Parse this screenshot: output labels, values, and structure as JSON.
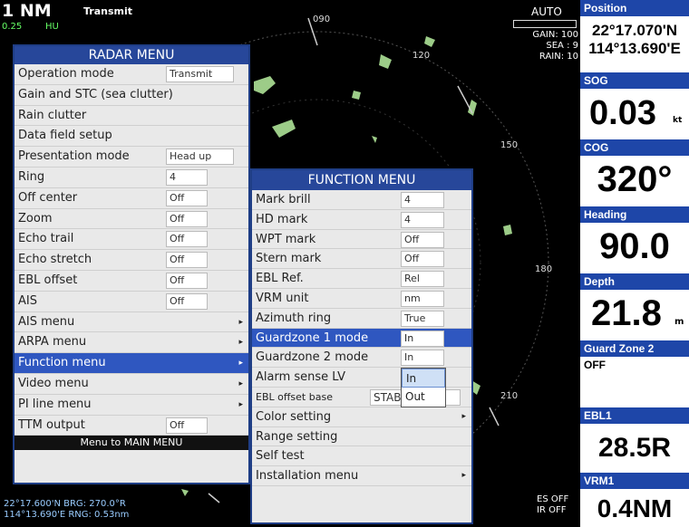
{
  "status": {
    "range": "1 NM",
    "tx": "Transmit",
    "ring_interval": "0.25",
    "orientation": "HU",
    "mode_auto": "AUTO",
    "gain": "GAIN: 100",
    "sea": "SEA :   9",
    "rain": "RAIN:  10",
    "es": "ES OFF",
    "ir": "IR OFF",
    "cursor_lat": "22°17.600'N  BRG: 270.0°R",
    "cursor_lon": "114°13.690'E  RNG: 0.53nm"
  },
  "bearings": [
    "090",
    "120",
    "150",
    "180",
    "210"
  ],
  "radar_menu": {
    "title": "RADAR MENU",
    "footer": "Menu to MAIN MENU",
    "items": [
      {
        "label": "Operation mode",
        "value": "Transmit"
      },
      {
        "label": "Gain and STC (sea clutter)"
      },
      {
        "label": "Rain clutter"
      },
      {
        "label": "Data field setup"
      },
      {
        "label": "Presentation mode",
        "value": "Head up"
      },
      {
        "label": "Ring",
        "value": "4"
      },
      {
        "label": "Off center",
        "value": "Off"
      },
      {
        "label": "Zoom",
        "value": "Off"
      },
      {
        "label": "Echo trail",
        "value": "Off"
      },
      {
        "label": "Echo stretch",
        "value": "Off"
      },
      {
        "label": "EBL offset",
        "value": "Off"
      },
      {
        "label": "AIS",
        "value": "Off"
      },
      {
        "label": "AIS menu",
        "submenu": true
      },
      {
        "label": "ARPA menu",
        "submenu": true
      },
      {
        "label": "Function menu",
        "submenu": true,
        "selected": true
      },
      {
        "label": "Video menu",
        "submenu": true
      },
      {
        "label": "PI line menu",
        "submenu": true
      },
      {
        "label": "TTM output",
        "value": "Off"
      }
    ]
  },
  "function_menu": {
    "title": "FUNCTION MENU",
    "items": [
      {
        "label": "Mark brill",
        "value": "4"
      },
      {
        "label": "HD mark",
        "value": "4"
      },
      {
        "label": "WPT mark",
        "value": "Off"
      },
      {
        "label": "Stern mark",
        "value": "Off"
      },
      {
        "label": "EBL Ref.",
        "value": "Rel"
      },
      {
        "label": "VRM unit",
        "value": "nm"
      },
      {
        "label": "Azimuth ring",
        "value": "True"
      },
      {
        "label": "Guardzone 1 mode",
        "value": "In",
        "selected": true
      },
      {
        "label": "Guardzone 2 mode",
        "value": "In"
      },
      {
        "label": "Alarm sense LV",
        "value": ""
      },
      {
        "label": "EBL offset base",
        "value": "STAB GND",
        "small": true
      },
      {
        "label": "Color setting",
        "submenu": true
      },
      {
        "label": "Range setting"
      },
      {
        "label": "Self test"
      },
      {
        "label": "Installation menu",
        "submenu": true
      }
    ],
    "dropdown_options": [
      "In",
      "Out"
    ]
  },
  "side_panel": {
    "position_title": "Position",
    "lat": "22°17.070'N",
    "lon": "114°13.690'E",
    "sog_title": "SOG",
    "sog": "0.03",
    "sog_unit": "kt",
    "cog_title": "COG",
    "cog": "320°",
    "heading_title": "Heading",
    "heading": "90.0",
    "depth_title": "Depth",
    "depth": "21.8",
    "depth_unit": "m",
    "guard_title": "Guard Zone 2",
    "guard": "OFF",
    "ebl_title": "EBL1",
    "ebl": "28.5R",
    "vrm_title": "VRM1",
    "vrm": "0.4NM"
  },
  "colors": {
    "menu_header": "#27479a",
    "selection": "#2f57c0",
    "echo": "#b8f0a0",
    "panel_header": "#1e46a8"
  }
}
